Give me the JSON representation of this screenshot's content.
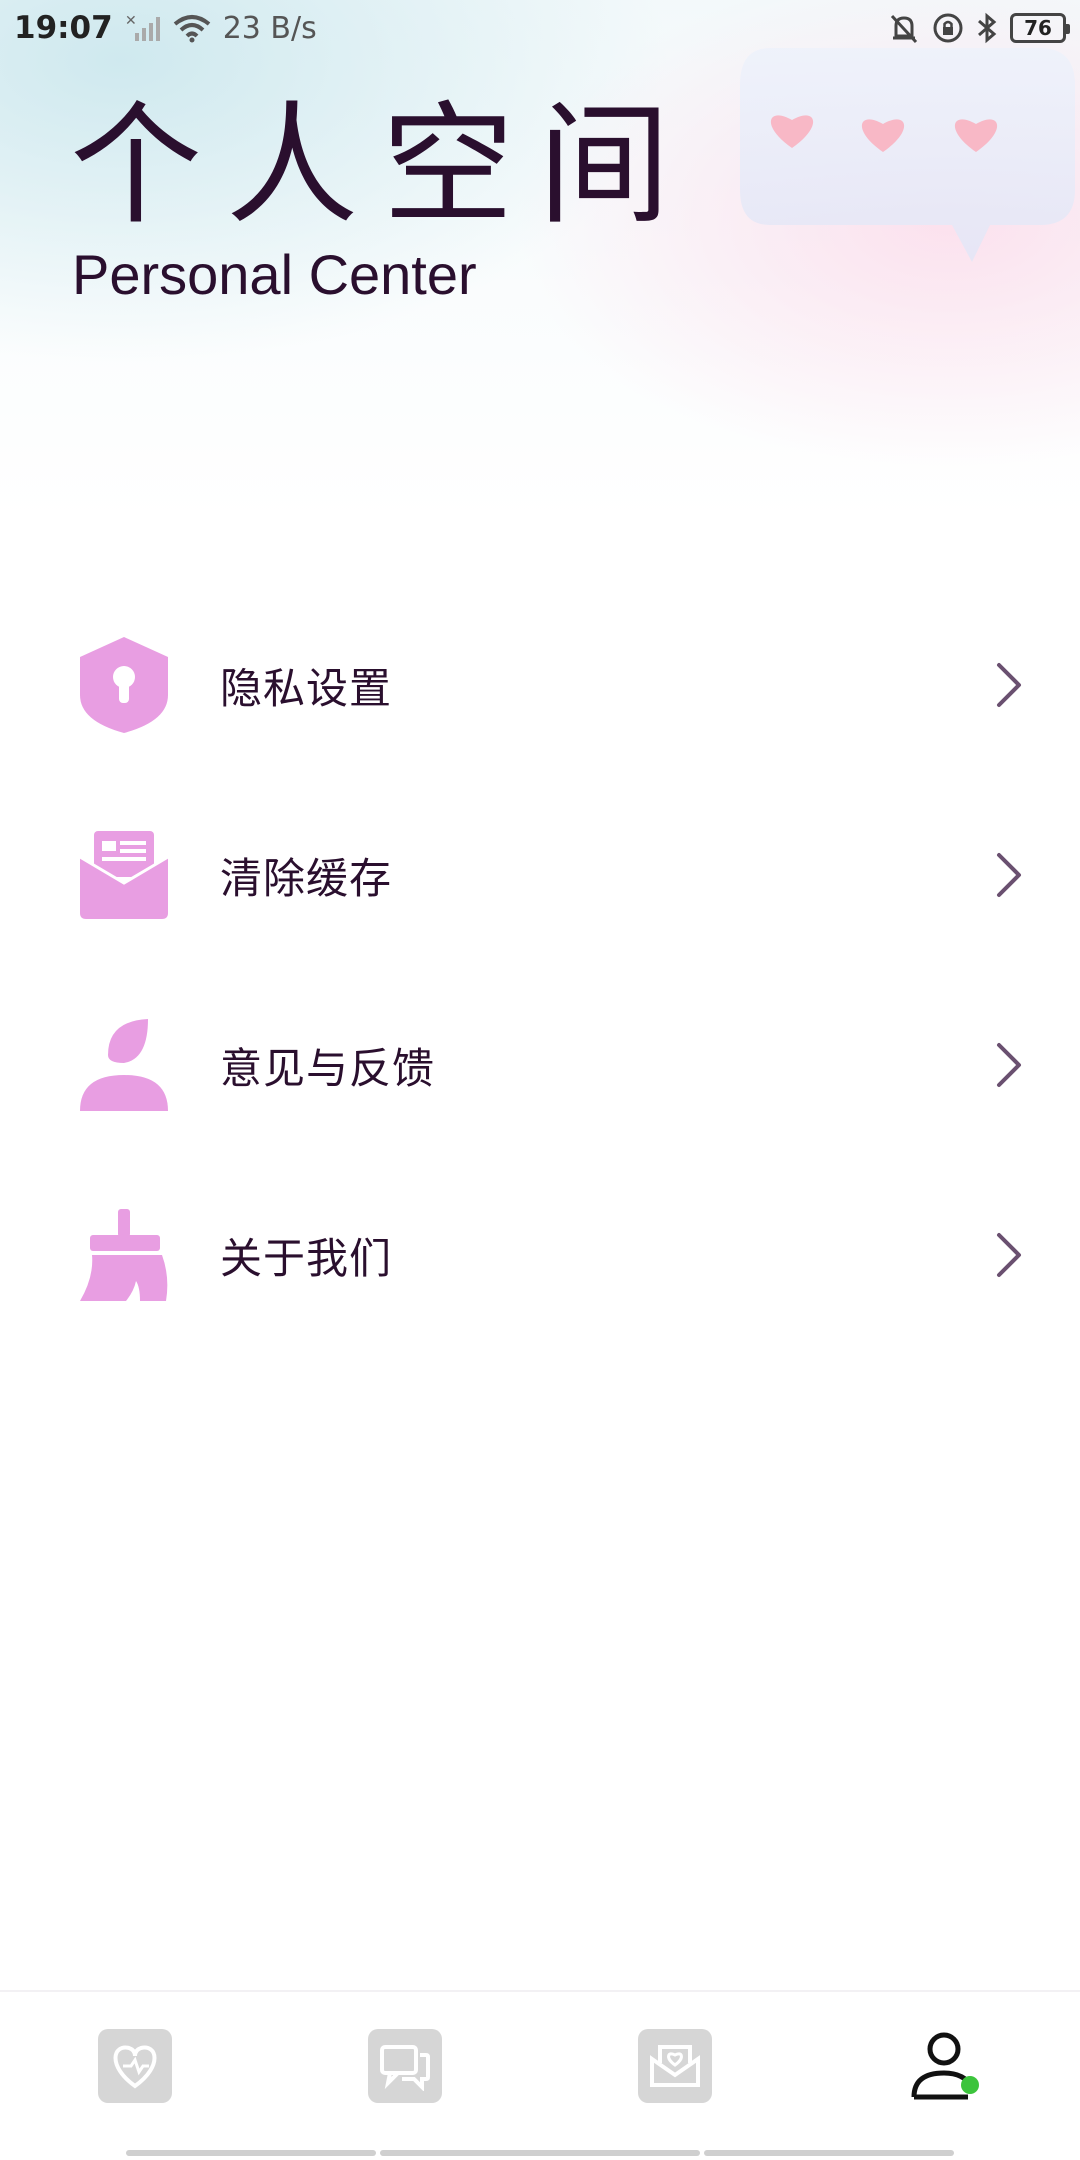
{
  "status_bar": {
    "time": "19:07",
    "network_speed": "23 B/s",
    "battery": "76",
    "icons": [
      "signal-x-icon",
      "wifi-icon",
      "mute-bell-icon",
      "rotation-lock-icon",
      "bluetooth-icon",
      "battery-icon"
    ]
  },
  "header": {
    "title_cn": "个人空间",
    "title_en": "Personal Center",
    "decoration_icon": "heart-chat-bubble-icon"
  },
  "menu": {
    "items": [
      {
        "label": "隐私设置",
        "icon": "shield-keyhole-icon"
      },
      {
        "label": "清除缓存",
        "icon": "mail-box-icon"
      },
      {
        "label": "意见与反馈",
        "icon": "person-icon"
      },
      {
        "label": "关于我们",
        "icon": "broom-icon"
      }
    ],
    "chevron_icon": "chevron-right-icon"
  },
  "bottom_nav": {
    "tabs": [
      {
        "name": "heart-tab",
        "icon": "heart-icon",
        "active": false
      },
      {
        "name": "messages-tab",
        "icon": "chat-icon",
        "active": false
      },
      {
        "name": "mail-tab",
        "icon": "heart-mail-icon",
        "active": false
      },
      {
        "name": "profile-tab",
        "icon": "user-icon",
        "active": true
      }
    ]
  },
  "colors": {
    "accent": "#e89ee2",
    "text": "#2a0f2e",
    "chevron": "#6a5070",
    "online_dot": "#3cc43c"
  }
}
